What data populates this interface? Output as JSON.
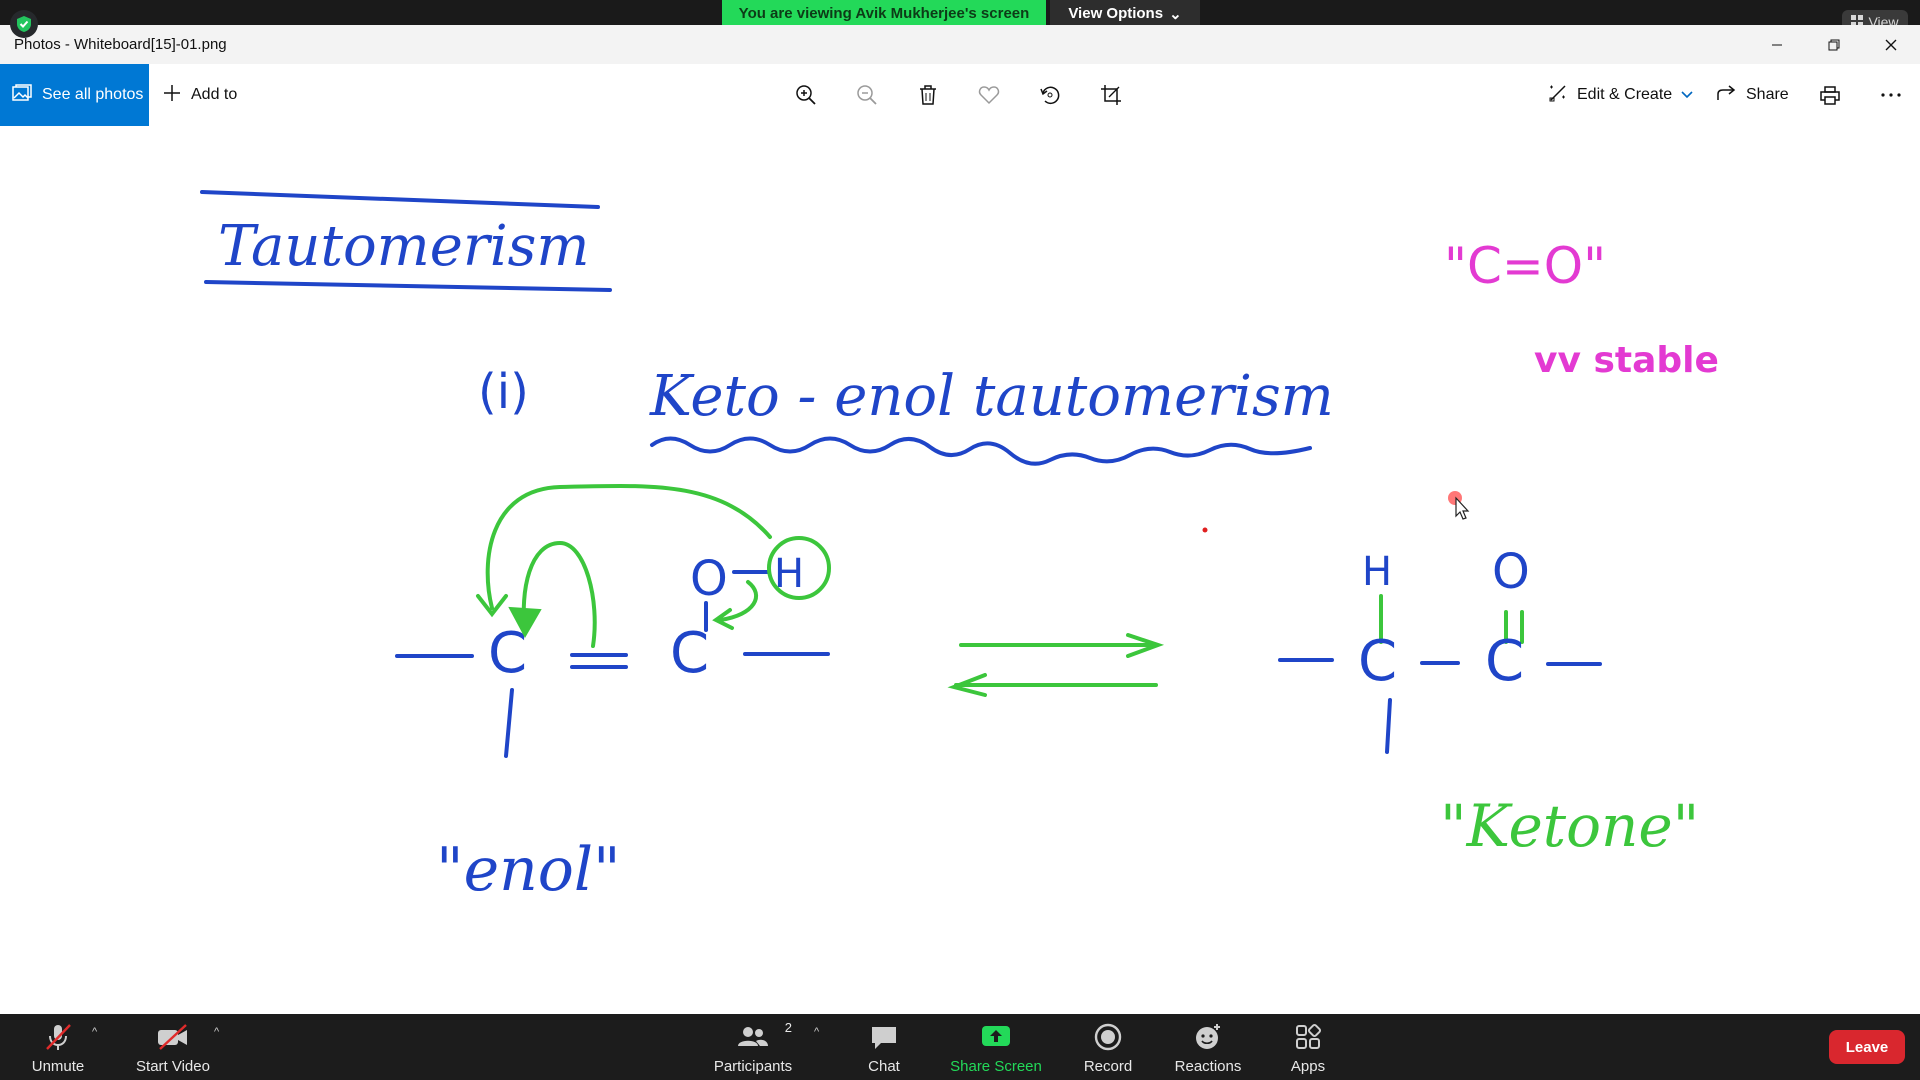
{
  "zoom": {
    "banner_text": "You are viewing Avik Mukherjee's screen",
    "view_options_label": "View Options",
    "view_label": "View"
  },
  "photos": {
    "window_title": "Photos - Whiteboard[15]-01.png",
    "see_all_label": "See all photos",
    "add_to_label": "Add to",
    "edit_create_label": "Edit & Create",
    "share_label": "Share"
  },
  "whiteboard": {
    "title": "Tautomerism",
    "index": "(i)",
    "subtitle": "Keto - enol tautomerism",
    "enol_label": "\"enol\"",
    "ketone_label": "\"Ketone\"",
    "co_note": "\"C=O\"",
    "stable_note": "vv stable",
    "enol_atoms": {
      "o": "O",
      "h": "H",
      "c1": "C",
      "c2": "C"
    },
    "keto_atoms": {
      "h": "H",
      "o": "O",
      "c1": "C",
      "c2": "C"
    },
    "colors": {
      "blue": "#1f45c8",
      "green": "#3cc63c",
      "pink": "#e33ad2"
    }
  },
  "bottom": {
    "unmute": "Unmute",
    "start_video": "Start Video",
    "participants": "Participants",
    "participants_count": "2",
    "chat": "Chat",
    "share_screen": "Share Screen",
    "record": "Record",
    "reactions": "Reactions",
    "apps": "Apps",
    "leave": "Leave"
  }
}
